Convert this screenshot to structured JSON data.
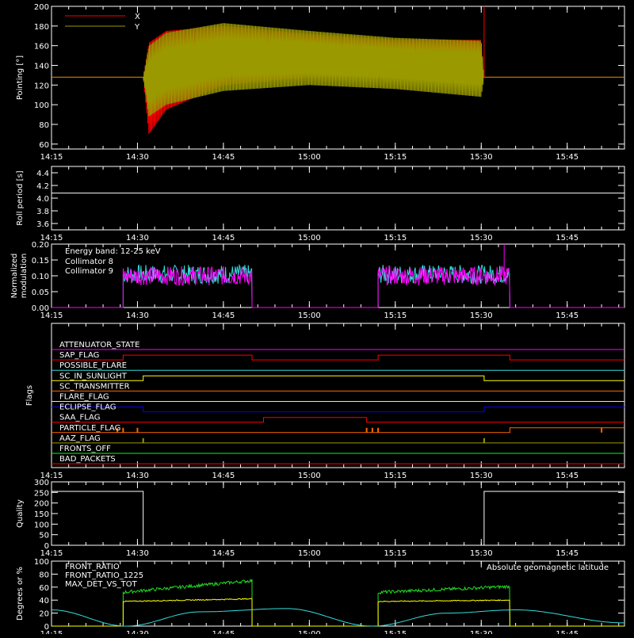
{
  "colors": {
    "background": "#000000",
    "axes": "#ffffff",
    "red": "#ff0000",
    "olive": "#9a9a00",
    "cyan": "#33dddd",
    "magenta": "#ff00ff",
    "white": "#ffffff",
    "yellow": "#ffff00",
    "orange": "#ff6600",
    "blue": "#0000ff",
    "green": "#00ff00",
    "lime": "#22dd22",
    "gold": "#e0c000"
  },
  "time_ticks": [
    "14:15",
    "14:30",
    "14:45",
    "15:00",
    "15:15",
    "15:30",
    "15:45"
  ],
  "chart_data": [
    {
      "id": "pointing",
      "type": "line",
      "ylabel": "Pointing [°]",
      "ylim": [
        55,
        200
      ],
      "yticks": [
        60,
        80,
        100,
        120,
        140,
        160,
        180,
        200
      ],
      "legend": [
        {
          "name": "X",
          "color": "red"
        },
        {
          "name": "Y",
          "color": "olive"
        }
      ],
      "x_range": [
        "14:15",
        "15:55"
      ],
      "series": [
        {
          "name": "X",
          "color": "red",
          "band": true,
          "x": [
            "14:15",
            "14:31",
            "14:32",
            "14:35",
            "14:45",
            "15:00",
            "15:15",
            "15:30",
            "15:30.5",
            "15:55"
          ],
          "low": [
            128,
            128,
            70,
            95,
            120,
            128,
            130,
            132,
            128,
            128
          ],
          "high": [
            128,
            128,
            163,
            175,
            180,
            172,
            166,
            166,
            128,
            128
          ]
        },
        {
          "name": "Y",
          "color": "olive",
          "band": true,
          "x": [
            "14:15",
            "14:31",
            "14:32",
            "14:35",
            "14:45",
            "15:00",
            "15:15",
            "15:30",
            "15:30.5",
            "15:55"
          ],
          "low": [
            128,
            128,
            88,
            100,
            114,
            120,
            116,
            108,
            128,
            128
          ],
          "high": [
            128,
            128,
            160,
            173,
            183,
            175,
            168,
            165,
            128,
            128
          ]
        }
      ]
    },
    {
      "id": "roll",
      "type": "line",
      "ylabel": "Roll period [s]",
      "ylim": [
        3.5,
        4.5
      ],
      "yticks": [
        3.6,
        3.8,
        4.0,
        4.2,
        4.4
      ],
      "series": [
        {
          "name": "",
          "color": "white",
          "x": [
            "14:15",
            "15:55"
          ],
          "y": [
            4.08,
            4.08
          ]
        }
      ]
    },
    {
      "id": "modulation",
      "type": "line",
      "ylabel": "Normalized modulation",
      "ylim": [
        0,
        0.2
      ],
      "yticks": [
        0.0,
        0.05,
        0.1,
        0.15,
        0.2
      ],
      "annotation": "Energy band: 12-25 keV",
      "legend": [
        {
          "name": "Collimator 8",
          "color": "cyan"
        },
        {
          "name": "Collimator 9",
          "color": "magenta"
        }
      ],
      "segments": [
        [
          "14:27.5",
          "14:50"
        ],
        [
          "15:12",
          "15:35"
        ]
      ],
      "series": [
        {
          "name": "Collimator 8",
          "color": "cyan",
          "mean": 0.105,
          "spread": 0.03
        },
        {
          "name": "Collimator 9",
          "color": "magenta",
          "mean": 0.1,
          "spread": 0.03
        }
      ]
    },
    {
      "id": "flags",
      "type": "line",
      "ylabel": "Flags",
      "flags": [
        {
          "name": "ATTENUATOR_STATE",
          "color": "magenta",
          "states": [
            [
              "14:15",
              "15:55",
              0
            ]
          ]
        },
        {
          "name": "SAP_FLAG",
          "color": "red",
          "states": [
            [
              "14:15",
              "14:27.5",
              0
            ],
            [
              "14:27.5",
              "14:50",
              1
            ],
            [
              "14:50",
              "15:12",
              0
            ],
            [
              "15:12",
              "15:35",
              1
            ],
            [
              "15:35",
              "15:55",
              0
            ]
          ]
        },
        {
          "name": "POSSIBLE_FLARE",
          "color": "cyan",
          "states": [
            [
              "14:15",
              "15:55",
              0
            ]
          ]
        },
        {
          "name": "SC_IN_SUNLIGHT",
          "color": "yellow",
          "states": [
            [
              "14:15",
              "14:31",
              0
            ],
            [
              "14:31",
              "15:30.5",
              1
            ],
            [
              "15:30.5",
              "15:55",
              0
            ]
          ]
        },
        {
          "name": "SC_TRANSMITTER",
          "color": "orange",
          "states": [
            [
              "14:15",
              "15:55",
              0
            ]
          ]
        },
        {
          "name": "FLARE_FLAG",
          "color": "yellow",
          "states": [
            [
              "14:15",
              "15:55",
              0
            ]
          ]
        },
        {
          "name": "ECLIPSE_FLAG",
          "color": "blue",
          "states": [
            [
              "14:15",
              "14:31",
              1
            ],
            [
              "14:31",
              "15:30.5",
              0
            ],
            [
              "15:30.5",
              "15:55",
              1
            ]
          ]
        },
        {
          "name": "SAA_FLAG",
          "color": "red",
          "states": [
            [
              "14:15",
              "14:52",
              0
            ],
            [
              "14:52",
              "15:10",
              1
            ],
            [
              "15:10",
              "15:55",
              0
            ]
          ]
        },
        {
          "name": "PARTICLE_FLAG",
          "color": "orange",
          "states": [
            [
              "14:15",
              "15:35",
              0
            ],
            [
              "15:35",
              "15:55",
              1
            ]
          ],
          "spikes": [
            "14:26.5",
            "14:27.5",
            "14:30",
            "15:10",
            "15:11",
            "15:12",
            "15:51"
          ]
        },
        {
          "name": "AAZ_FLAG",
          "color": "olive",
          "states": [
            [
              "14:15",
              "15:55",
              0
            ]
          ],
          "spikes": [
            "14:31",
            "15:30.5"
          ]
        },
        {
          "name": "FRONTS_OFF",
          "color": "green",
          "states": [
            [
              "14:15",
              "15:55",
              0
            ]
          ]
        },
        {
          "name": "BAD_PACKETS",
          "color": "red",
          "states": [
            [
              "14:15",
              "15:55",
              0
            ]
          ]
        }
      ]
    },
    {
      "id": "quality",
      "type": "line",
      "ylabel": "Quality",
      "ylim": [
        0,
        300
      ],
      "yticks": [
        0,
        50,
        100,
        150,
        200,
        250,
        300
      ],
      "series": [
        {
          "name": "",
          "color": "white",
          "x": [
            "14:15",
            "14:31",
            "14:31",
            "15:30.5",
            "15:30.5",
            "15:55"
          ],
          "y": [
            255,
            255,
            0,
            0,
            255,
            255
          ]
        }
      ]
    },
    {
      "id": "geomag",
      "type": "line",
      "ylabel": "Degrees or %",
      "ylim": [
        0,
        100
      ],
      "yticks": [
        0,
        20,
        40,
        60,
        80,
        100
      ],
      "legend": [
        {
          "name": "FRONT_RATIO",
          "color": "yellow"
        },
        {
          "name": "FRONT_RATIO_1225",
          "color": "lime"
        },
        {
          "name": "MAX_DET_VS_TOT",
          "color": "orange"
        }
      ],
      "annotation_right": "Absolute geomagnetic latitude",
      "segments": [
        [
          "14:27.5",
          "14:50"
        ],
        [
          "15:12",
          "15:35"
        ]
      ],
      "series": [
        {
          "name": "FRONT_RATIO_1225",
          "color": "lime",
          "start": 52,
          "end": 70
        },
        {
          "name": "FRONT_RATIO",
          "color": "yellow",
          "start": 38,
          "end": 42
        },
        {
          "name": "Absolute geomagnetic latitude",
          "color": "cyan",
          "curve": true,
          "x": [
            "14:15",
            "14:28",
            "14:41",
            "14:56",
            "15:11",
            "15:24",
            "15:36",
            "15:55"
          ],
          "y": [
            25,
            0,
            22,
            27,
            0,
            20,
            25,
            5
          ]
        }
      ]
    }
  ]
}
